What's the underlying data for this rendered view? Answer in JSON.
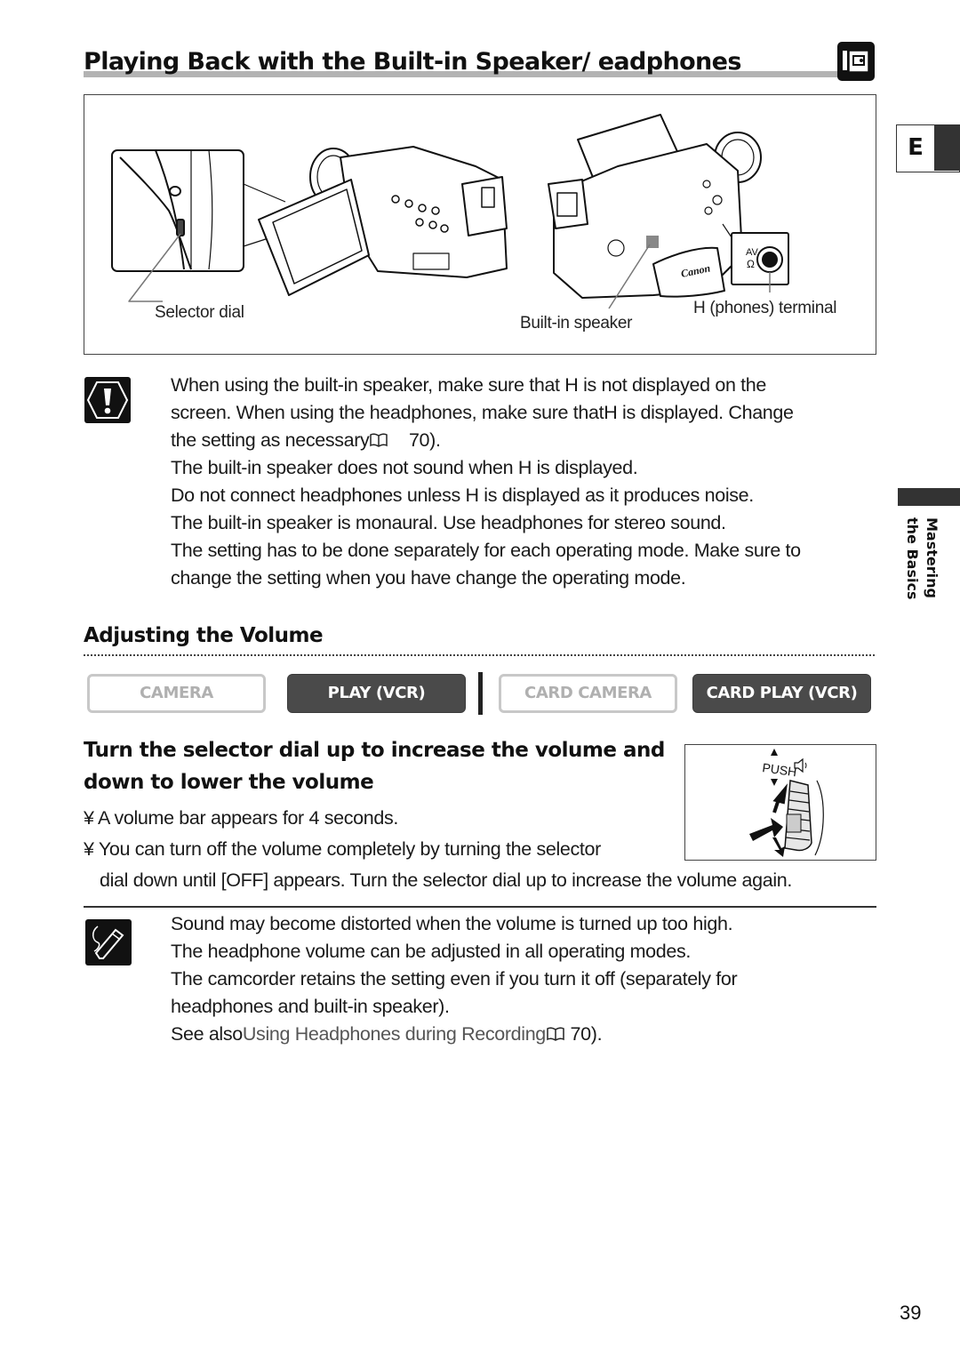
{
  "header": {
    "title": "Playing Back with the Built-in Speaker/   eadphones",
    "title_icon": "play-vcr-mode-icon",
    "language_tab": "E"
  },
  "side_tab": {
    "line1": "Mastering",
    "line2": "the Basics"
  },
  "figure": {
    "callouts": {
      "selector_dial": "Selector dial",
      "built_in_speaker": "Built-in speaker",
      "phones_terminal": "H (phones) terminal",
      "jack_label_av": "AV",
      "jack_label_phones": "Ω",
      "brand": "Canon"
    }
  },
  "caution": {
    "icon": "caution-icon",
    "lines": [
      "When using the built-in speaker, make sure that H  is not displayed on the",
      "screen. When using the headphones, make sure thatH  is displayed. Change",
      "the setting as necessary",
      "The built-in speaker does not sound when H  is displayed.",
      "Do not connect headphones unless H  is displayed as it produces noise.",
      "The built-in speaker is monaural. Use headphones for stereo sound.",
      "The setting has to be done separately for each operating mode. Make sure to",
      "change the setting when you have change the operating mode."
    ],
    "ref_page": "70)."
  },
  "section": {
    "heading": "Adjusting the Volume",
    "modes": [
      {
        "label": "CAMERA",
        "active": false
      },
      {
        "label": "PLAY (VCR)",
        "active": true
      },
      {
        "label": "CARD CAMERA",
        "active": false
      },
      {
        "label": "CARD PLAY (VCR)",
        "active": true
      }
    ],
    "step_heading_line1": "Turn the selector dial up to increase the volume  and",
    "step_heading_line2": "down to lower the volume",
    "bullets": [
      "¥ A volume bar appears for 4 seconds.",
      "¥ You can turn off the volume completely by turning the selector",
      "dial down until [OFF] appears. Turn the selector dial up to increase the volume again."
    ],
    "dial_figure": {
      "push_label": "PUSH",
      "speaker_icon": "speaker-icon"
    }
  },
  "note": {
    "icon": "note-pencil-icon",
    "lines": [
      "Sound may become distorted when the volume is turned up too high.",
      "The headphone volume can be adjusted in all operating modes.",
      "The camcorder retains the setting even if you turn it off (separately for",
      "headphones and built-in speaker).",
      "See also",
      "Using Headphones during Recording"
    ],
    "ref_page": "70)."
  },
  "footer": {
    "page_number": "39"
  }
}
